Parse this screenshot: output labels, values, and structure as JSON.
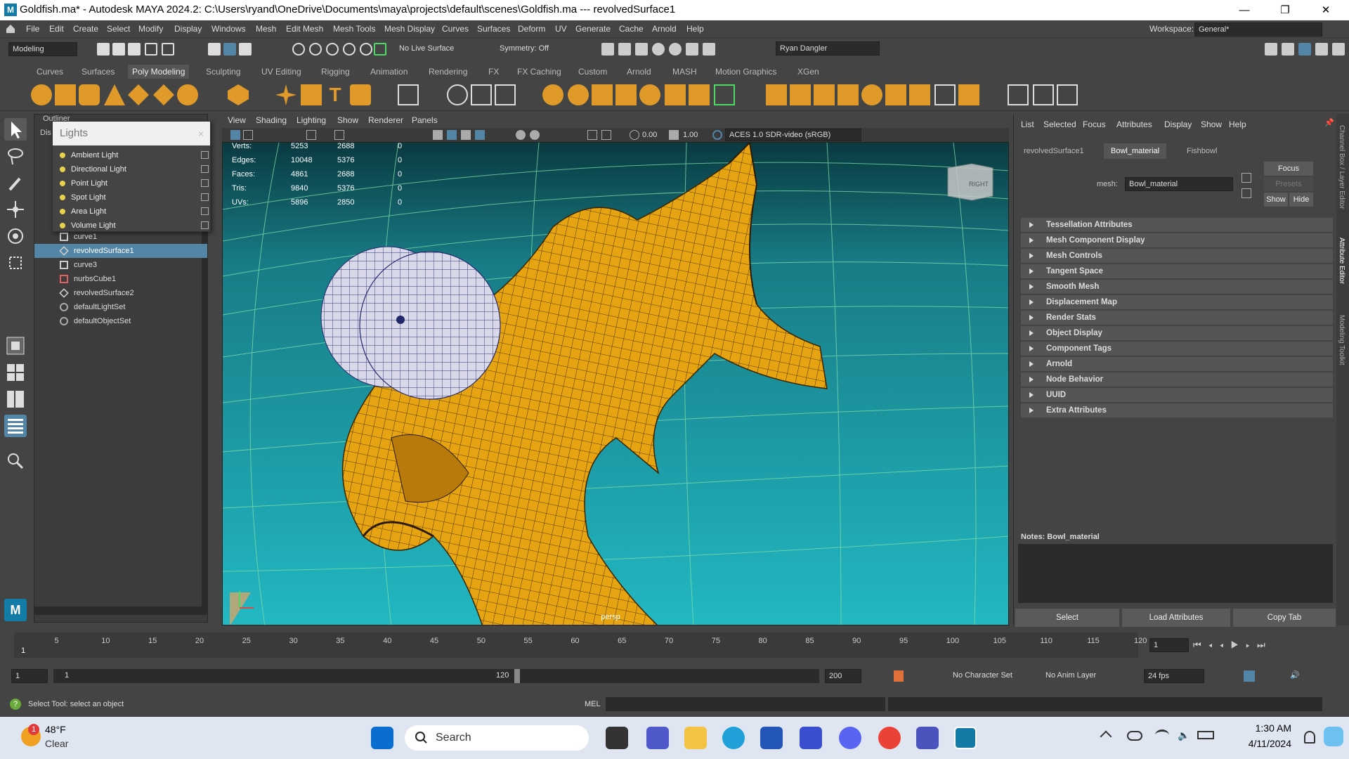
{
  "titlebar": {
    "logo": "M",
    "title": "Goldfish.ma* - Autodesk MAYA 2024.2: C:\\Users\\ryand\\OneDrive\\Documents\\maya\\projects\\default\\scenes\\Goldfish.ma   ---   revolvedSurface1",
    "minimize": "—",
    "maximize": "❐",
    "close": "✕"
  },
  "menubar": {
    "items": [
      "File",
      "Edit",
      "Create",
      "Select",
      "Modify",
      "Display",
      "Windows",
      "Mesh",
      "Edit Mesh",
      "Mesh Tools",
      "Mesh Display",
      "Curves",
      "Surfaces",
      "Deform",
      "UV",
      "Generate",
      "Cache",
      "Arnold",
      "Help"
    ],
    "workspace_label": "Workspace:",
    "workspace_value": "General*"
  },
  "statusline": {
    "menuset": "Modeling",
    "live_surface": "No Live Surface",
    "symmetry": "Symmetry: Off",
    "user": "Ryan Dangler"
  },
  "shelf_tabs": [
    "Curves",
    "Surfaces",
    "Poly Modeling",
    "Sculpting",
    "UV Editing",
    "Rigging",
    "Animation",
    "Rendering",
    "FX",
    "FX Caching",
    "Custom",
    "Arnold",
    "MASH",
    "Motion Graphics",
    "XGen"
  ],
  "shelf_active": "Poly Modeling",
  "outliner": {
    "title": "Outliner",
    "display": "Dis",
    "items": [
      {
        "label": "curve1",
        "type": "curve"
      },
      {
        "label": "revolvedSurface1",
        "type": "surface",
        "selected": true
      },
      {
        "label": "curve3",
        "type": "curve"
      },
      {
        "label": "nurbsCube1",
        "type": "nurbs"
      },
      {
        "label": "revolvedSurface2",
        "type": "surface"
      },
      {
        "label": "defaultLightSet",
        "type": "set"
      },
      {
        "label": "defaultObjectSet",
        "type": "set"
      }
    ]
  },
  "lights_popup": {
    "title": "Lights",
    "close": "×",
    "items": [
      "Ambient Light",
      "Directional Light",
      "Point Light",
      "Spot Light",
      "Area Light",
      "Volume Light"
    ]
  },
  "viewport": {
    "menus": [
      "View",
      "Shading",
      "Lighting",
      "Show",
      "Renderer",
      "Panels"
    ],
    "exposure": "0.00",
    "gamma": "1.00",
    "colorspace": "ACES 1.0 SDR-video (sRGB)",
    "camera": "persp",
    "cube_label": "RIGHT",
    "hud": [
      {
        "label": "Verts:",
        "a": "5253",
        "b": "2688",
        "c": "0"
      },
      {
        "label": "Edges:",
        "a": "10048",
        "b": "5376",
        "c": "0"
      },
      {
        "label": "Faces:",
        "a": "4861",
        "b": "2688",
        "c": "0"
      },
      {
        "label": "Tris:",
        "a": "9840",
        "b": "5376",
        "c": "0"
      },
      {
        "label": "UVs:",
        "a": "5896",
        "b": "2850",
        "c": "0"
      }
    ],
    "colors": {
      "water": "#1fa6b2",
      "fish": "#e6a413",
      "eye": "#d8d8e8",
      "grid": "#7fe0a8"
    }
  },
  "attribute_editor": {
    "menus": [
      "List",
      "Selected",
      "Focus",
      "Attributes",
      "Display",
      "Show",
      "Help"
    ],
    "tabs": [
      "revolvedSurface1",
      "Bowl_material",
      "Fishbowl"
    ],
    "active_tab": "Bowl_material",
    "mesh_label": "mesh:",
    "mesh_value": "Bowl_material",
    "focus": "Focus",
    "presets": "Presets",
    "show": "Show",
    "hide": "Hide",
    "sections": [
      "Tessellation Attributes",
      "Mesh Component Display",
      "Mesh Controls",
      "Tangent Space",
      "Smooth Mesh",
      "Displacement Map",
      "Render Stats",
      "Object Display",
      "Component Tags",
      "Arnold",
      "Node Behavior",
      "UUID",
      "Extra Attributes"
    ],
    "notes_label": "Notes:  Bowl_material",
    "buttons": [
      "Select",
      "Load Attributes",
      "Copy Tab"
    ],
    "side_tabs": [
      "Channel Box / Layer Editor",
      "Attribute Editor",
      "Modeling Toolkit"
    ]
  },
  "timeline": {
    "ticks": [
      "5",
      "10",
      "15",
      "20",
      "25",
      "30",
      "35",
      "40",
      "45",
      "50",
      "55",
      "60",
      "65",
      "70",
      "75",
      "80",
      "85",
      "90",
      "95",
      "100",
      "105",
      "110",
      "115",
      "120"
    ],
    "current": "1",
    "current_frame": "1"
  },
  "range": {
    "start": "1",
    "inner_start": "1",
    "inner_end": "120",
    "end": "200",
    "character_set": "No Character Set",
    "anim_layer": "No Anim Layer",
    "fps": "24 fps"
  },
  "cmd": {
    "help": "Select Tool: select an object",
    "lang": "MEL"
  },
  "taskbar": {
    "temp": "48°F",
    "weather": "Clear",
    "badge": "1",
    "search": "Search",
    "time": "1:30 AM",
    "date": "4/11/2024"
  }
}
